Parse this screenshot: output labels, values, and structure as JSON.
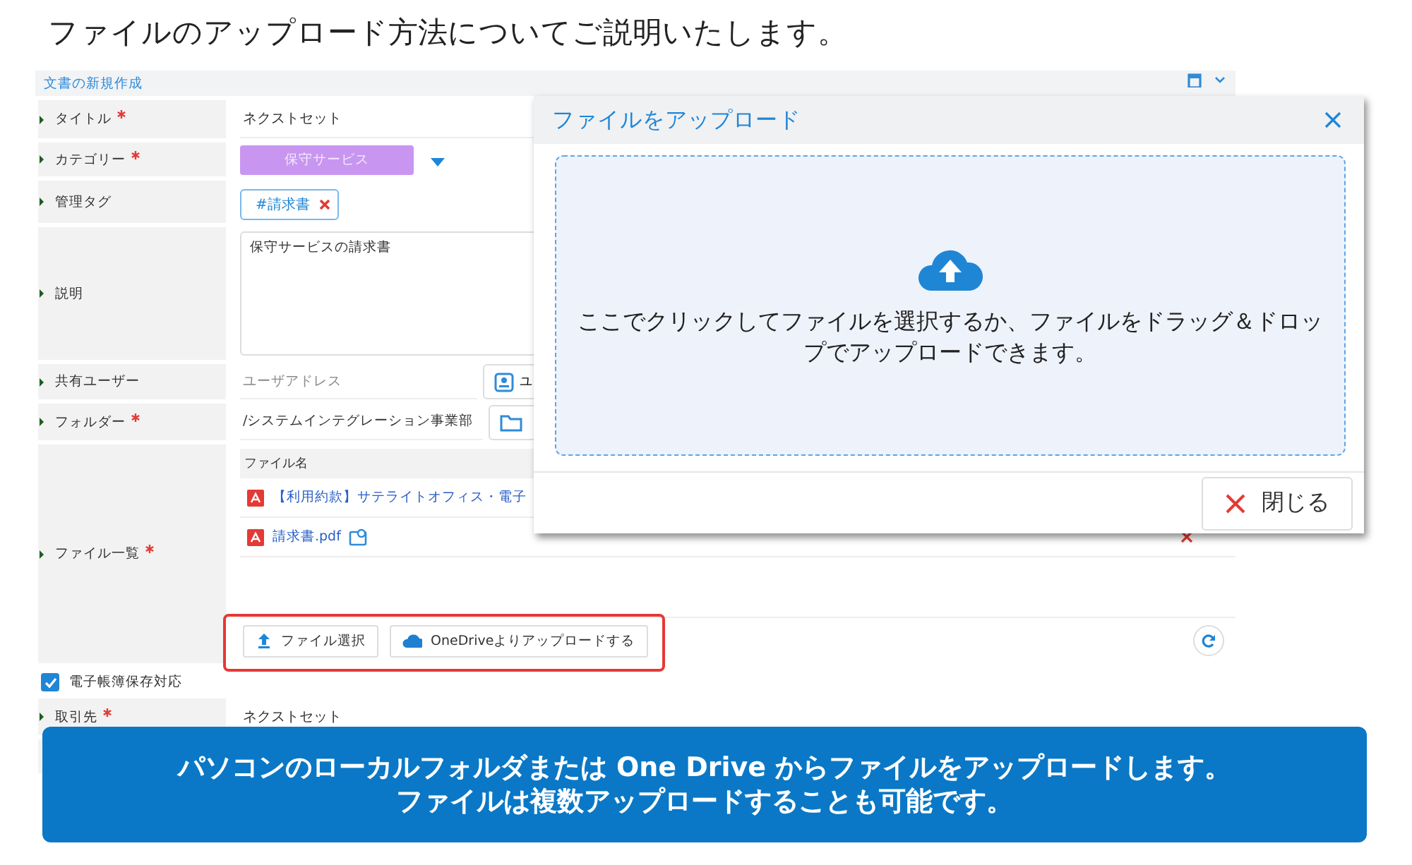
{
  "heading": "ファイルのアップロード方法についてご説明いたします。",
  "form": {
    "title": "文書の新規作成",
    "fields": [
      {
        "kind": "text",
        "label": "タイトル",
        "required": true,
        "value": "ネクストセット"
      },
      {
        "kind": "category",
        "label": "カテゴリー",
        "required": true,
        "value": "保守サービス"
      },
      {
        "kind": "tags",
        "label": "管理タグ",
        "required": false,
        "tags": [
          "#請求書"
        ]
      },
      {
        "kind": "textarea",
        "label": "説明",
        "required": false,
        "value": "保守サービスの請求書"
      },
      {
        "kind": "user",
        "label": "共有ユーザー",
        "required": false,
        "placeholder": "ユーザアドレス",
        "button": "ユ"
      },
      {
        "kind": "folder",
        "label": "フォルダー",
        "required": true,
        "value": "/システムインテグレーション事業部"
      },
      {
        "kind": "files",
        "label": "ファイル一覧",
        "required": true,
        "column": "ファイル名",
        "highlighted": true,
        "files": [
          {
            "name": "【利用約款】サテライトオフィス・電子",
            "shared": false
          },
          {
            "name": "請求書.pdf",
            "shared": true,
            "removable": true
          }
        ],
        "buttons": [
          {
            "kind": "local",
            "label": "ファイル選択"
          },
          {
            "kind": "onedrive",
            "label": "OneDriveよりアップロードする"
          }
        ]
      }
    ],
    "checkbox": {
      "label": "電子帳簿保存対応",
      "checked": true
    },
    "extra_fields": [
      {
        "label": "取引先",
        "required": true,
        "value": "ネクストセット"
      }
    ]
  },
  "dialog": {
    "title": "ファイルをアップロード",
    "message": "ここでクリックしてファイルを選択するか、ファイルをドラッグ＆ドロップでアップロードできます。",
    "close": "閉じる"
  },
  "banner": [
    "パソコンのローカルフォルダまたは One Drive からファイルをアップロードします。",
    "ファイルは複数アップロードすることも可能です。"
  ]
}
